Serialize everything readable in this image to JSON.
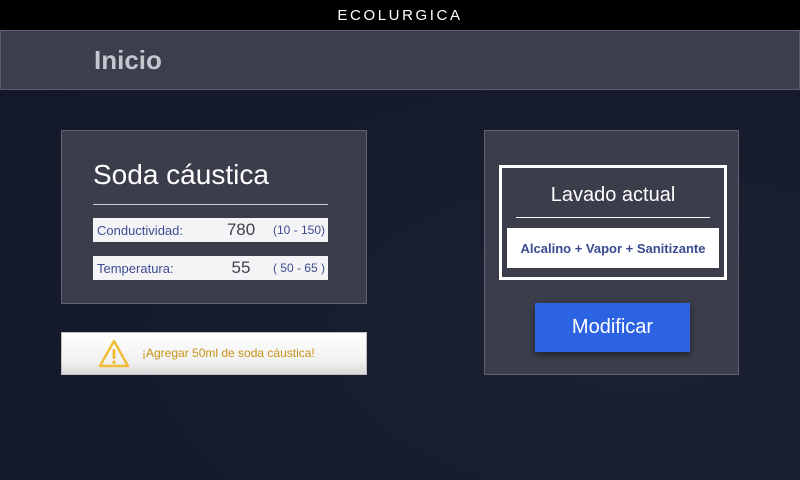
{
  "app": {
    "brand": "ECOLURGICA"
  },
  "header": {
    "title": "Inicio"
  },
  "soda": {
    "title": "Soda cáustica",
    "rows": [
      {
        "label": "Conductividad:",
        "value": "780",
        "range": "(10 - 150)"
      },
      {
        "label": "Temperatura:",
        "value": "55",
        "range": "( 50 - 65 )"
      }
    ]
  },
  "alert": {
    "icon": "warning-icon",
    "message": "¡Agregar 50ml de soda cáustica!"
  },
  "wash": {
    "title": "Lavado actual",
    "value": "Alcalino + Vapor + Sanitizante",
    "modify_label": "Modificar"
  },
  "colors": {
    "background": "#161c2c",
    "panel": "#3b3d4b",
    "accent": "#2b63e2",
    "label_text": "#3e4d93",
    "warning": "#f2bb34"
  }
}
